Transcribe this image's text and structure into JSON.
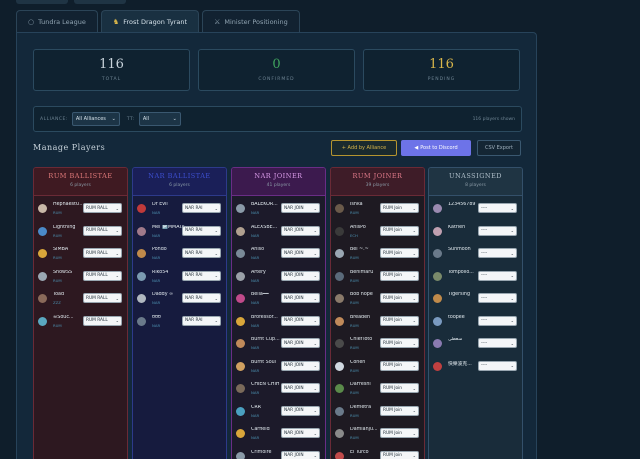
{
  "tabs": [
    {
      "icon": "circle-icon",
      "glyph": "○",
      "label": "Tundra League",
      "active": false
    },
    {
      "icon": "dragon-icon",
      "glyph": "♞",
      "label": "Frost Dragon Tyrant",
      "active": true
    },
    {
      "icon": "swords-icon",
      "glyph": "⚔",
      "label": "Minister Positioning",
      "active": false
    }
  ],
  "stats": [
    {
      "value": "116",
      "label": "TOTAL",
      "color": "#c9d4dc"
    },
    {
      "value": "0",
      "label": "CONFIRMED",
      "color": "#3fa35e"
    },
    {
      "value": "116",
      "label": "PENDING",
      "color": "#d9b64a"
    }
  ],
  "filters": {
    "alliance_label": "ALLIANCE:",
    "alliance_value": "All Alliances",
    "tier_label": "TT:",
    "tier_value": "All",
    "shown": "116 players shown"
  },
  "manage": {
    "title": "Manage Players",
    "add": "+ Add by Alliance",
    "post": "Post to Discord",
    "post_icon": "◀",
    "csv": "CSV Export"
  },
  "columns": [
    {
      "name": "RUM BALLISTAE",
      "count": "6 players",
      "head_bg": "#3f1a22",
      "body_bg": "#2d1820",
      "border": "#6a2a36",
      "name_color": "#e07a7a",
      "players": [
        {
          "name": "HephaestU...",
          "alliance": "RUM",
          "sel": "RUM RALL",
          "av": "#c9b8a8"
        },
        {
          "name": "Lightning",
          "alliance": "RUM",
          "sel": "RUM RALL",
          "av": "#4a8ac9"
        },
        {
          "name": "SIMBA",
          "alliance": "RUM",
          "sel": "RUM RALL",
          "av": "#d9a63a"
        },
        {
          "name": "SnowSS",
          "alliance": "RUM",
          "sel": "RUM RALL",
          "av": "#9aa7b3"
        },
        {
          "name": "Toad",
          "alliance": "ZZZ",
          "sel": "RUM RALL",
          "av": "#8a6a5a"
        },
        {
          "name": "☠Souc...",
          "alliance": "RUM",
          "sel": "RUM RALL",
          "av": "#5aa8c0"
        }
      ]
    },
    {
      "name": "NAR BALLISTAE",
      "count": "6 players",
      "head_bg": "#1a1f58",
      "body_bg": "#161b3e",
      "border": "#2d3a8a",
      "name_color": "#3d4fd0",
      "players": [
        {
          "name": "Dr Evil",
          "alliance": "NAR",
          "sel": "NAR RAI",
          "av": "#c03a3a"
        },
        {
          "name": "Mel 🅿️MMATA",
          "alliance": "NAR",
          "sel": "NAR RAI",
          "av": "#a07a8a"
        },
        {
          "name": "Pondo",
          "alliance": "NAR",
          "sel": "NAR RAI",
          "av": "#c08a4a"
        },
        {
          "name": "Riko54",
          "alliance": "NAR",
          "sel": "NAR RAI",
          "av": "#7a9ab0"
        },
        {
          "name": "Daddy ∞",
          "alliance": "NAR",
          "sel": "NAR RAI",
          "av": "#b0b8c0"
        },
        {
          "name": "ʊʊʊ",
          "alliance": "NAR",
          "sel": "NAR RAI",
          "av": "#6a7a8a"
        }
      ]
    },
    {
      "name": "NAR JOINER",
      "count": "41 players",
      "head_bg": "#3c1a4e",
      "body_bg": "#1c1a2a",
      "border": "#6a2d86",
      "name_color": "#d99ae8",
      "players": [
        {
          "name": "BALEKOR...",
          "alliance": "NAR",
          "sel": "NAR JOIN",
          "av": "#8a9aa8"
        },
        {
          "name": "ALEXSBE...",
          "alliance": "NAR",
          "sel": "NAR JOIN",
          "av": "#b0a090"
        },
        {
          "name": "Aniso",
          "alliance": "NAR",
          "sel": "NAR JOIN",
          "av": "#7a8a98"
        },
        {
          "name": "Artery",
          "alliance": "NAR",
          "sel": "NAR JOIN",
          "av": "#9aa0a8"
        },
        {
          "name": "Bella━━",
          "alliance": "NAR",
          "sel": "NAR JOIN",
          "av": "#c04a8a"
        },
        {
          "name": "Brofessor...",
          "alliance": "NAR",
          "sel": "NAR JOIN",
          "av": "#d9a63a"
        },
        {
          "name": "Burnt Cup...",
          "alliance": "NAR",
          "sel": "NAR JOIN",
          "av": "#c08a5a"
        },
        {
          "name": "Burnt Soul",
          "alliance": "NAR",
          "sel": "NAR JOIN",
          "av": "#d0a060"
        },
        {
          "name": "CHIEN CHIH",
          "alliance": "NAR",
          "sel": "NAR JOIN",
          "av": "#7a6a5a"
        },
        {
          "name": "CRR",
          "alliance": "NAR",
          "sel": "NAR JOIN",
          "av": "#4aa0c0"
        },
        {
          "name": "Carfield",
          "alliance": "NAR",
          "sel": "NAR JOIN",
          "av": "#d9a63a"
        },
        {
          "name": "Crimoire",
          "alliance": "NAR",
          "sel": "NAR JOIN",
          "av": "#8a9aa8"
        }
      ]
    },
    {
      "name": "RUM JOINER",
      "count": "39 players",
      "head_bg": "#3e1c28",
      "body_bg": "#1e1a22",
      "border": "#6a2a36",
      "name_color": "#e07a8a",
      "players": [
        {
          "name": "Ishka",
          "alliance": "RUM",
          "sel": "RUM Join",
          "av": "#6a5a4a"
        },
        {
          "name": "AnisPo",
          "alliance": "ECH",
          "sel": "RUM Join",
          "av": "#3a3a3a"
        },
        {
          "name": "Bel ~.~",
          "alliance": "RUM",
          "sel": "RUM Join",
          "av": "#9aa7b3"
        },
        {
          "name": "Benimaru",
          "alliance": "RUM",
          "sel": "RUM Join",
          "av": "#5a6a7a"
        },
        {
          "name": "Bob hope",
          "alliance": "RUM",
          "sel": "RUM Join",
          "av": "#8a7a6a"
        },
        {
          "name": "Breaden",
          "alliance": "RUM",
          "sel": "RUM Join",
          "av": "#c08a5a"
        },
        {
          "name": "ChiefToto",
          "alliance": "RUM",
          "sel": "RUM Join",
          "av": "#4a4a4a"
        },
        {
          "name": "Cohen",
          "alliance": "RUM",
          "sel": "RUM Join",
          "av": "#d0d8e0"
        },
        {
          "name": "DaFreshi",
          "alliance": "RUM",
          "sel": "RUM Join",
          "av": "#5a8a4a"
        },
        {
          "name": "Demetra",
          "alliance": "RUM",
          "sel": "RUM Join",
          "av": "#6a7a8a"
        },
        {
          "name": "Damianju...",
          "alliance": "RUM",
          "sel": "RUM Join",
          "av": "#8a8a8a"
        },
        {
          "name": "El Turco",
          "alliance": "ZZZ",
          "sel": "RUM Join",
          "av": "#c04a4a"
        }
      ]
    },
    {
      "name": "Unassigned",
      "count": "8 players",
      "head_bg": "#1f3443",
      "body_bg": "#192c3a",
      "border": "#34506a",
      "name_color": "#b0bfca",
      "players": [
        {
          "name": "123456789",
          "alliance": "",
          "sel": "----",
          "av": "#9a8ab0"
        },
        {
          "name": "Katrien",
          "alliance": "",
          "sel": "----",
          "av": "#c0a0b0"
        },
        {
          "name": "Sunmoon",
          "alliance": "",
          "sel": "----",
          "av": "#6a7a8a"
        },
        {
          "name": "Tompollo...",
          "alliance": "",
          "sel": "----",
          "av": "#7a8a6a"
        },
        {
          "name": "Tigersing",
          "alliance": "",
          "sel": "----",
          "av": "#c08a4a"
        },
        {
          "name": "toopee",
          "alliance": "",
          "sel": "----",
          "av": "#7a9ac0"
        },
        {
          "name": "سعطی",
          "alliance": "",
          "sel": "----",
          "av": "#8a7ab0"
        },
        {
          "name": "快樂波克...",
          "alliance": "",
          "sel": "----",
          "av": "#c04040"
        }
      ]
    }
  ]
}
